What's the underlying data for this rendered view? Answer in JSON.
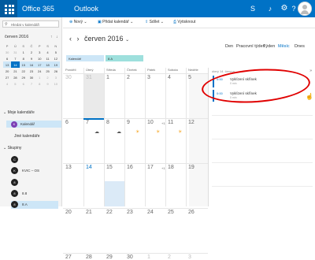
{
  "topbar": {
    "brand": "Office 365",
    "app": "Outlook",
    "icons": [
      "skype-icon",
      "bell-icon",
      "gear-icon",
      "help-icon"
    ]
  },
  "left": {
    "search_placeholder": "Hledat v kalendáři",
    "mini_month": "červen 2016",
    "mini_days": [
      "P",
      "Ú",
      "S",
      "Č",
      "P",
      "S",
      "N"
    ],
    "mini_weeks": [
      [
        "30",
        "31",
        "1",
        "2",
        "3",
        "4",
        "5"
      ],
      [
        "6",
        "7",
        "8",
        "9",
        "10",
        "11",
        "12"
      ],
      [
        "13",
        "14",
        "15",
        "16",
        "17",
        "18",
        "19"
      ],
      [
        "20",
        "21",
        "22",
        "23",
        "24",
        "25",
        "26"
      ],
      [
        "27",
        "28",
        "29",
        "30",
        "1",
        "2",
        "3"
      ],
      [
        "4",
        "5",
        "6",
        "7",
        "8",
        "9",
        "10"
      ]
    ],
    "my_calendars": "Moje kalendáře",
    "calendar_item": "Kalendář",
    "calendar_avatar": "K",
    "other_calendars": "Jiné kalendáře",
    "groups": "Skupiny",
    "group_items": [
      {
        "icon": "C",
        "label": ""
      },
      {
        "icon": "K",
        "label": "KVIC – OS"
      },
      {
        "icon": "8",
        "label": ""
      },
      {
        "icon": "8",
        "label": "8.8"
      },
      {
        "icon": "8",
        "label": "8.A"
      }
    ]
  },
  "cmd": {
    "new": "Nový",
    "add_cal": "Přidat kalendář",
    "share": "Sdílet",
    "print": "Vytisknout"
  },
  "main": {
    "month_title": "červen 2016",
    "views": [
      "Den",
      "Pracovní týden",
      "Týden",
      "Měsíc",
      "Dnes"
    ],
    "legend1": "Kalendář",
    "legend2": "8.A",
    "dow": [
      "Pondělí",
      "Úterý",
      "Středa",
      "Čtvrtek",
      "Pátek",
      "Sobota",
      "Neděle"
    ],
    "weeks": [
      [
        "30",
        "31",
        "1",
        "2",
        "3",
        "4",
        "5"
      ],
      [
        "6",
        "7",
        "8",
        "9",
        "10",
        "11",
        "12"
      ],
      [
        "13",
        "14",
        "15",
        "16",
        "17",
        "18",
        "19"
      ],
      [
        "20",
        "21",
        "22",
        "23",
        "24",
        "25",
        "26"
      ],
      [
        "27",
        "28",
        "29",
        "30",
        "1",
        "2",
        "3"
      ]
    ],
    "plus": "+1"
  },
  "panel": {
    "header": "úterý 14. června",
    "events": [
      {
        "time": "0:00",
        "title": "Vyklízení skřínek",
        "duration": "0 min"
      },
      {
        "time": "0:00",
        "title": "Vyklízení skřínek",
        "duration": "0 min"
      }
    ],
    "times": [
      "",
      "",
      ""
    ]
  }
}
